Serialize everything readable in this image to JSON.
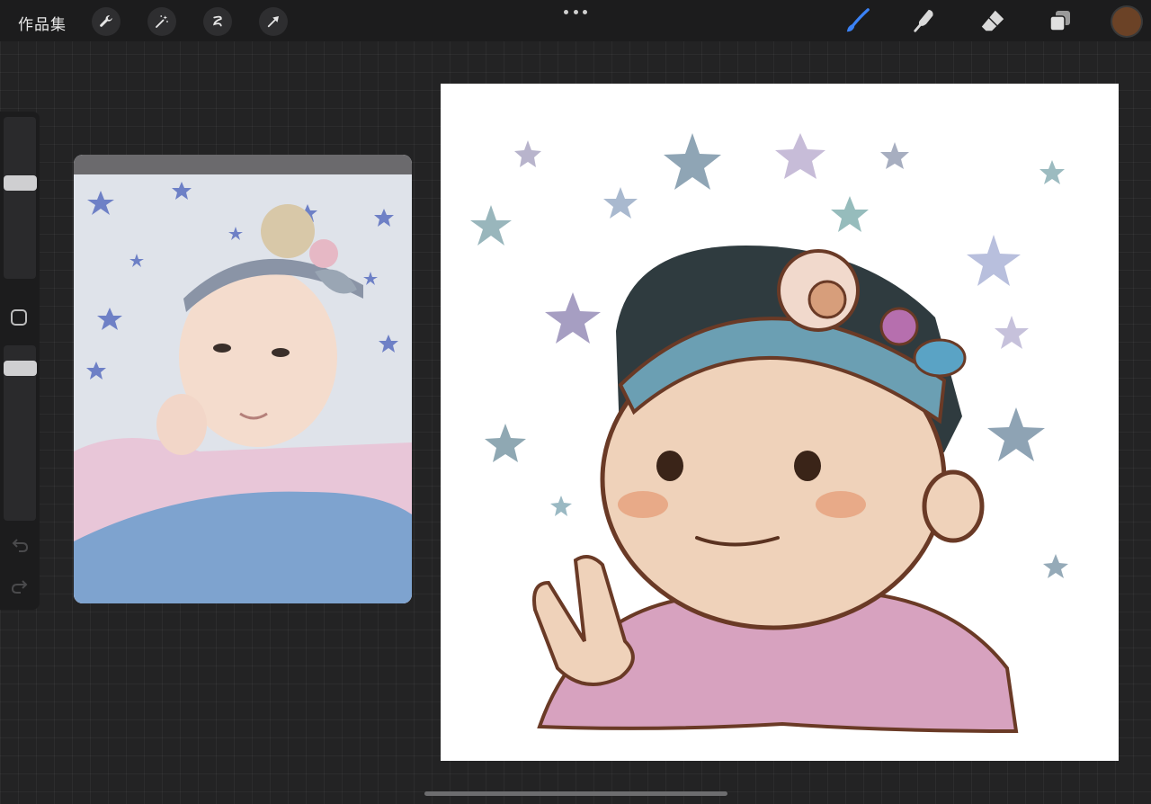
{
  "topbar": {
    "gallery_label": "作品集",
    "left_tools": [
      "wrench-icon",
      "magic-wand-icon",
      "selection-icon",
      "move-arrow-icon"
    ],
    "right_tools": [
      "brush-icon",
      "smudge-icon",
      "eraser-icon",
      "layers-icon"
    ],
    "active_tool": "brush-icon",
    "accent_color": "#3b82f6",
    "current_color": "#6b4226"
  },
  "sidebar": {
    "controls": [
      "brush-size-slider",
      "modifier-button",
      "opacity-slider",
      "undo-icon",
      "redo-icon"
    ]
  },
  "reference": {
    "description_icon": "photo-reference"
  },
  "canvas": {
    "background": "#ffffff"
  }
}
